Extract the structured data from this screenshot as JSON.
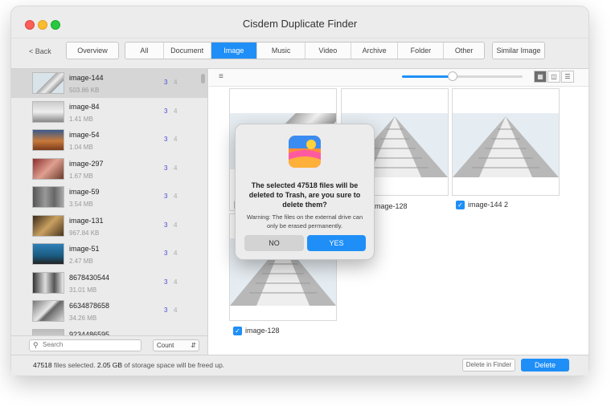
{
  "window": {
    "title": "Cisdem Duplicate Finder"
  },
  "toolbar": {
    "back_label": "< Back",
    "overview_label": "Overview",
    "tabs": [
      {
        "label": "All"
      },
      {
        "label": "Document"
      },
      {
        "label": "Image"
      },
      {
        "label": "Music"
      },
      {
        "label": "Video"
      },
      {
        "label": "Archive"
      },
      {
        "label": "Folder"
      },
      {
        "label": "Other"
      }
    ],
    "active_tab": "Image",
    "similar_label": "Similar Image"
  },
  "sidebar": {
    "items": [
      {
        "name": "image-144",
        "size": "503.86 KB",
        "count_a": "3",
        "count_b": "4"
      },
      {
        "name": "image-84",
        "size": "1.41 MB",
        "count_a": "3",
        "count_b": "4"
      },
      {
        "name": "image-54",
        "size": "1.04 MB",
        "count_a": "3",
        "count_b": "4"
      },
      {
        "name": "image-297",
        "size": "1.67 MB",
        "count_a": "3",
        "count_b": "4"
      },
      {
        "name": "image-59",
        "size": "3.54 MB",
        "count_a": "3",
        "count_b": "4"
      },
      {
        "name": "image-131",
        "size": "967.84 KB",
        "count_a": "3",
        "count_b": "4"
      },
      {
        "name": "image-51",
        "size": "2.47 MB",
        "count_a": "3",
        "count_b": "4"
      },
      {
        "name": "8678430544",
        "size": "31.01 MB",
        "count_a": "3",
        "count_b": "4"
      },
      {
        "name": "6634878658",
        "size": "34.26 MB",
        "count_a": "3",
        "count_b": "4"
      },
      {
        "name": "9234486595",
        "size": "",
        "count_a": "",
        "count_b": ""
      }
    ],
    "search_placeholder": "Search",
    "sort_label": "Count"
  },
  "grid": {
    "cards": [
      {
        "label": ""
      },
      {
        "label": "image-128"
      },
      {
        "label": "image-144 2"
      },
      {
        "label": "image-128"
      }
    ],
    "zoom_fraction": 0.42
  },
  "dialog": {
    "title": "The selected 47518 files will be deleted to Trash, are you sure to delete them?",
    "warning": "Warning: The files on the external drive can only be erased permanently.",
    "no_label": "NO",
    "yes_label": "YES"
  },
  "status": {
    "files": "47518",
    "files_text": " files selected. ",
    "space": "2.05 GB",
    "space_text": " of storage space will be freed up.",
    "delete_in_finder": "Delete in Finder",
    "delete": "Delete"
  },
  "colors": {
    "accent": "#1f8ff7",
    "count_blue": "#4a4ad8"
  }
}
